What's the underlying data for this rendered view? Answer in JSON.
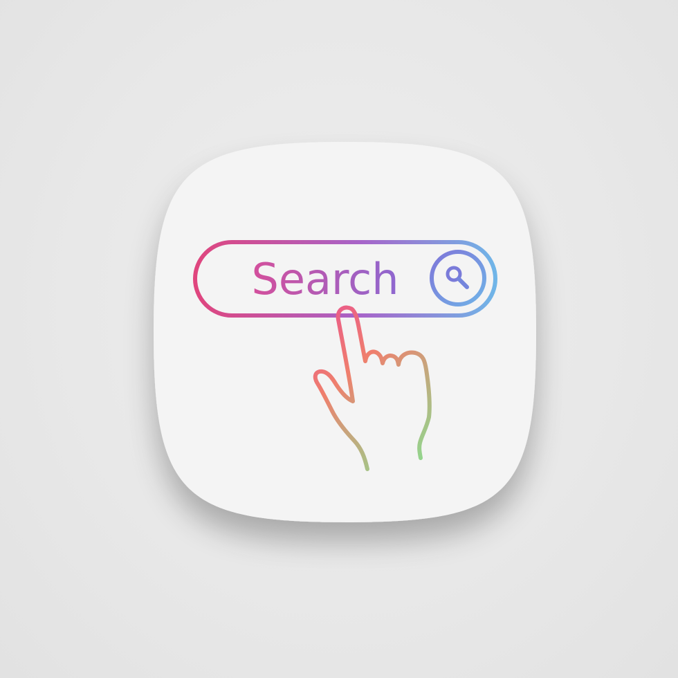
{
  "app_icon": {
    "search_bar": {
      "label": "Search",
      "button_icon": "magnifier-icon"
    },
    "pointer": {
      "icon": "pointing-hand-icon"
    }
  },
  "colors": {
    "background": "#e6e6e6",
    "tile": "#f3f3f3",
    "gradient_pink": "#e0457d",
    "gradient_purple": "#a65fc9",
    "gradient_blue": "#6fb4e6",
    "gradient_orange": "#ec7b6c",
    "gradient_green": "#8fd58a"
  }
}
